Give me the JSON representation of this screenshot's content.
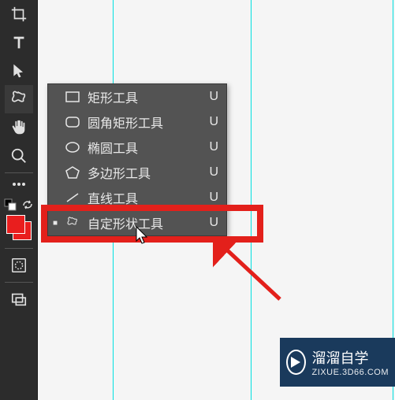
{
  "flyout": {
    "items": [
      {
        "label": "矩形工具",
        "shortcut": "U",
        "icon": "rect"
      },
      {
        "label": "圆角矩形工具",
        "shortcut": "U",
        "icon": "round-rect"
      },
      {
        "label": "椭圆工具",
        "shortcut": "U",
        "icon": "ellipse"
      },
      {
        "label": "多边形工具",
        "shortcut": "U",
        "icon": "polygon"
      },
      {
        "label": "直线工具",
        "shortcut": "U",
        "icon": "line"
      },
      {
        "label": "自定形状工具",
        "shortcut": "U",
        "icon": "custom",
        "active": true
      }
    ]
  },
  "watermark": {
    "title": "溜溜自学",
    "sub": "ZIXUE.3D66.COM"
  },
  "colors": {
    "fg": "#e91e1e",
    "bg": "#e91e1e"
  }
}
